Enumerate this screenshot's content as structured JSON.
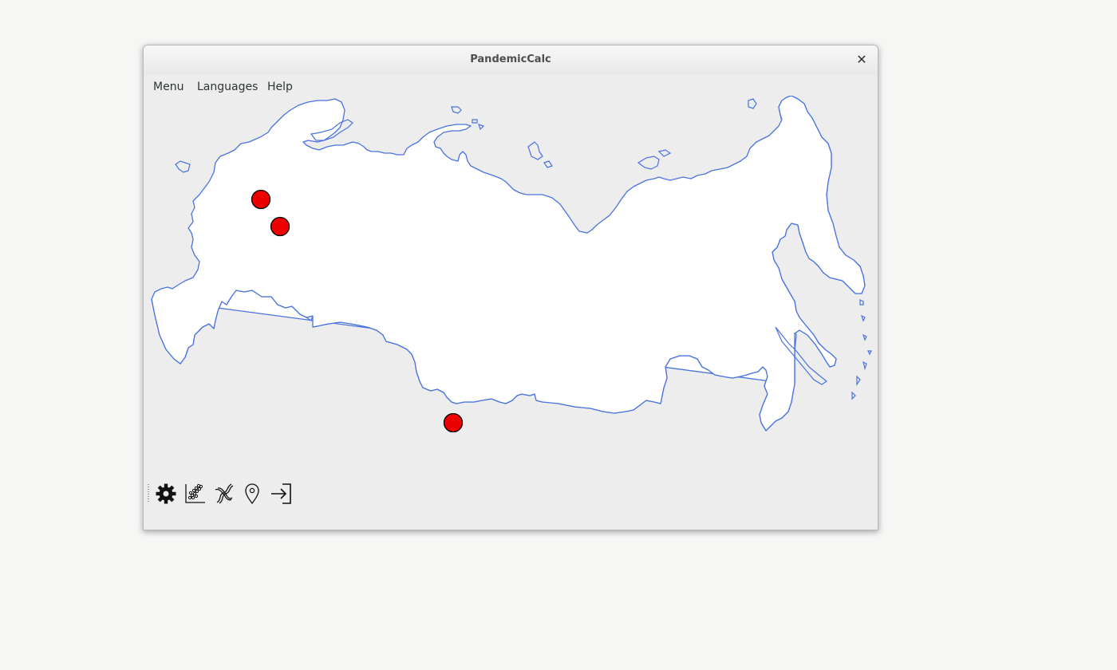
{
  "window": {
    "title": "PandemicCalc"
  },
  "menubar": {
    "items": [
      {
        "label": "Menu"
      },
      {
        "label": "Languages"
      },
      {
        "label": "Help"
      }
    ]
  },
  "map": {
    "region": "Russia",
    "fill_color": "#ffffff",
    "outline_color": "#4a72e0",
    "markers": [
      {
        "color": "#ee0000"
      },
      {
        "color": "#ee0000"
      },
      {
        "color": "#ee0000"
      }
    ]
  },
  "toolbar": {
    "icons": [
      "gear-icon",
      "scatter-chart-icon",
      "dna-icon",
      "location-pin-icon",
      "exit-icon"
    ]
  },
  "colors": {
    "background": "#f6f6f5",
    "window": "#ededed",
    "marker": "#ee0000"
  }
}
